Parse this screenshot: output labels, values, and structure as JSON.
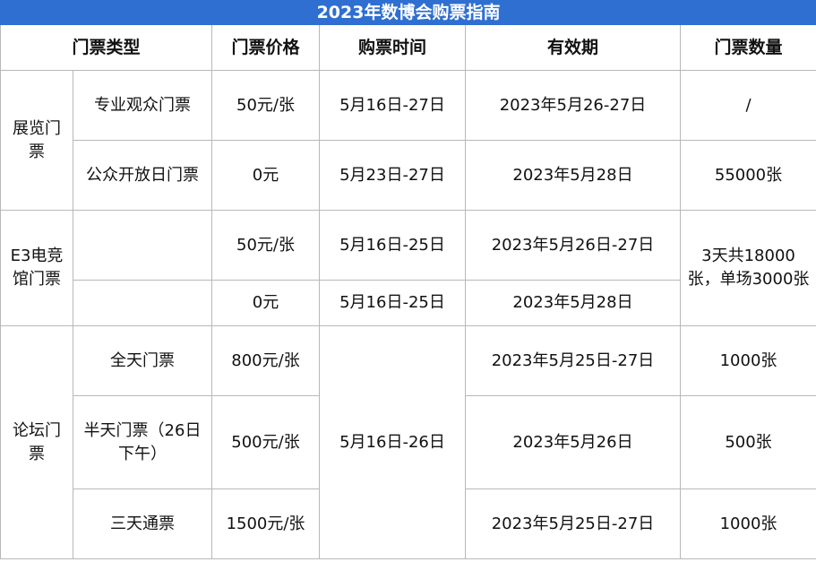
{
  "title": "2023年数博会购票指南",
  "headers": {
    "type": "门票类型",
    "price": "门票价格",
    "time": "购票时间",
    "validity": "有效期",
    "quantity": "门票数量"
  },
  "exhibition": {
    "category": "展览门票",
    "rows": [
      {
        "subtype": "专业观众门票",
        "price": "50元/张",
        "time": "5月16日-27日",
        "validity": "2023年5月26-27日",
        "quantity": "/"
      },
      {
        "subtype": "公众开放日门票",
        "price": "0元",
        "time": "5月23日-27日",
        "validity": "2023年5月28日",
        "quantity": "55000张"
      }
    ]
  },
  "esports": {
    "category": "E3电竞馆门票",
    "rows": [
      {
        "subtype": "",
        "price": "50元/张",
        "time": "5月16日-25日",
        "validity": "2023年5月26日-27日"
      },
      {
        "subtype": "",
        "price": "0元",
        "time": "5月16日-25日",
        "validity": "2023年5月28日"
      }
    ],
    "quantity": "3天共18000张，单场3000张"
  },
  "forum": {
    "category": "论坛门票",
    "time": "5月16日-26日",
    "rows": [
      {
        "subtype": "全天门票",
        "price": "800元/张",
        "validity": "2023年5月25日-27日",
        "quantity": "1000张"
      },
      {
        "subtype": "半天门票（26日下午）",
        "price": "500元/张",
        "validity": "2023年5月26日",
        "quantity": "500张"
      },
      {
        "subtype": "三天通票",
        "price": "1500元/张",
        "validity": "2023年5月25日-27日",
        "quantity": "1000张"
      }
    ]
  }
}
